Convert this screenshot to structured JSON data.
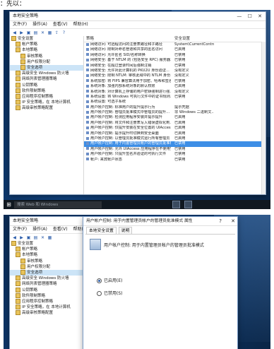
{
  "caption": "：先以：",
  "screen1": {
    "window_title": "本地安全策略",
    "menu": [
      "文件(F)",
      "操作(A)",
      "查看(V)",
      "帮助(H)"
    ],
    "tree": [
      {
        "label": "安全设置",
        "level": 0
      },
      {
        "label": "帐户策略",
        "level": 1
      },
      {
        "label": "本地策略",
        "level": 1
      },
      {
        "label": "审核策略",
        "level": 2
      },
      {
        "label": "用户权限分配",
        "level": 2
      },
      {
        "label": "安全选项",
        "level": 2,
        "selected": true
      },
      {
        "label": "高级安全 Windows 防火墙",
        "level": 1
      },
      {
        "label": "网络列表管理器策略",
        "level": 1
      },
      {
        "label": "公钥策略",
        "level": 1
      },
      {
        "label": "软件限制策略",
        "level": 1
      },
      {
        "label": "应用程序控制策略",
        "level": 1
      },
      {
        "label": "IP 安全策略，在 本地计算机",
        "level": 1
      },
      {
        "label": "高级审核策略配置",
        "level": 1
      }
    ],
    "col_policy": "策略",
    "col_setting": "安全设置",
    "rows": [
      {
        "policy": "网络访问: 可远程访问的注册表路径和子路径",
        "setting": "System\\CurrentContro..."
      },
      {
        "policy": "网络访问: 限制对命名管道和共享的匿名访问",
        "setting": "已启用"
      },
      {
        "policy": "网络访问: 允许匿名 SID/名称转换",
        "setting": "已禁用"
      },
      {
        "policy": "网络安全: 基于 NTLM 的 (包括安全 RPC) 服务器...",
        "setting": "已禁用"
      },
      {
        "policy": "网络安全: 在超过登录时间后强制注销",
        "setting": "已禁用"
      },
      {
        "policy": "网络安全: 允许对此计算机的 PKU2U 身份验证...",
        "setting": "没有定义"
      },
      {
        "policy": "网络安全: 限制 NTLM: 审核此域中的 NTLM 身份...",
        "setting": "没有定义"
      },
      {
        "policy": "系统加密: 将 FIPS 兼容算法用于加密、哈希和签名",
        "setting": "已禁用"
      },
      {
        "policy": "系统对象: 加强内部系统对象的默认权限",
        "setting": "已启用"
      },
      {
        "policy": "系统对象: 对计算机上存储的用户密钥强制进行强...",
        "setting": "没有定义"
      },
      {
        "policy": "系统设置: 将 Windows 可执行文件中的证书规则...",
        "setting": "已禁用"
      },
      {
        "policy": "系统设置: 可选子系统",
        "setting": ""
      },
      {
        "policy": "用户帐户控制: 标准用户的提升提示行为",
        "setting": "提示凭据"
      },
      {
        "policy": "用户帐户控制: 管理员批准模式中管理员的提升...",
        "setting": "非 Windows 二进制文..."
      },
      {
        "policy": "用户帐户控制: 检测应用程序安装并提示提升",
        "setting": "已启用"
      },
      {
        "policy": "用户帐户控制: 将文件和注册表写入错误虚拟化到...",
        "setting": "已启用"
      },
      {
        "policy": "用户帐户控制: 仅提升安装在安全位置的 UIAccess...",
        "setting": "已启用"
      },
      {
        "policy": "用户帐户控制: 提示提升时切换到安全桌面",
        "setting": "已启用"
      },
      {
        "policy": "用户帐户控制: 以管理员批准模式运行所有管理员",
        "setting": "已启用"
      },
      {
        "policy": "用户帐户控制: 用于内置管理员帐户的管理员批准模式",
        "setting": "已禁用",
        "selected": true
      },
      {
        "policy": "用户帐户控制: 允许 UIAccess 应用程序在不使用安全...",
        "setting": "已禁用"
      },
      {
        "policy": "用户帐户控制: 只提升签名并验证的可执行文件",
        "setting": "已禁用"
      },
      {
        "policy": "帐户: 来宾帐户状态",
        "setting": "已禁用"
      }
    ],
    "taskbar_search": "搜索 Web 和 Windows"
  },
  "screen2": {
    "window_title": "本地安全策略",
    "menu": [
      "文件(F)",
      "操作(A)",
      "查看(V)",
      "帮助(H)"
    ],
    "tree": [
      {
        "label": "安全设置",
        "level": 0
      },
      {
        "label": "帐户策略",
        "level": 1
      },
      {
        "label": "本地策略",
        "level": 1
      },
      {
        "label": "审核策略",
        "level": 2
      },
      {
        "label": "用户权限分配",
        "level": 2
      },
      {
        "label": "安全选项",
        "level": 2,
        "selected": true
      },
      {
        "label": "高级安全 Windows 防火墙",
        "level": 1
      },
      {
        "label": "网络列表管理器策略",
        "level": 1
      },
      {
        "label": "公钥策略",
        "level": 1
      },
      {
        "label": "软件限制策略",
        "level": 1
      },
      {
        "label": "应用程序控制策略",
        "level": 1
      },
      {
        "label": "IP 安全策略，在 本地计算机",
        "level": 1
      },
      {
        "label": "高级审核策略配置",
        "level": 1
      }
    ],
    "dialog": {
      "title": "用户帐户控制: 用于内置管理员帐户的管理员批准模式 属性",
      "help": "?",
      "close": "✕",
      "tabs": [
        "本地安全设置",
        "说明"
      ],
      "policy_name": "用户帐户控制: 用于内置管理员帐户的管理员批准模式",
      "option_enabled": "已启用(E)",
      "option_disabled": "已禁用(S)",
      "selected_option": "enabled"
    }
  }
}
